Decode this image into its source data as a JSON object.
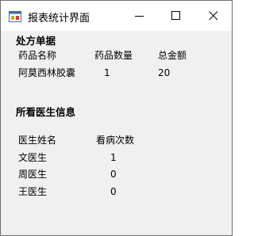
{
  "window": {
    "title": "报表统计界面"
  },
  "prescription": {
    "heading": "处方单据",
    "columns": [
      "药品名称",
      "药品数量",
      "总金额"
    ],
    "row": {
      "name": "阿莫西林胶囊",
      "quantity": "1",
      "total": "20"
    }
  },
  "doctors": {
    "heading": "所看医生信息",
    "columns": [
      "医生姓名",
      "看病次数"
    ],
    "rows": [
      {
        "name": "文医生",
        "count": "1"
      },
      {
        "name": "周医生",
        "count": "0"
      },
      {
        "name": "王医生",
        "count": "0"
      }
    ]
  },
  "icons": {
    "app": "form-app-icon",
    "minimize": "minimize-icon",
    "maximize": "maximize-icon",
    "close": "close-icon"
  }
}
